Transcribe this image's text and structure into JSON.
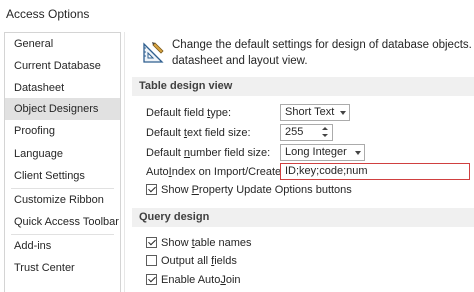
{
  "window": {
    "title": "Access Options"
  },
  "sidebar": {
    "items": [
      {
        "label": "General"
      },
      {
        "label": "Current Database"
      },
      {
        "label": "Datasheet"
      },
      {
        "label": "Object Designers",
        "selected": true
      },
      {
        "label": "Proofing"
      },
      {
        "label": "Language"
      },
      {
        "label": "Client Settings"
      },
      {
        "label": "Customize Ribbon"
      },
      {
        "label": "Quick Access Toolbar"
      },
      {
        "label": "Add-ins"
      },
      {
        "label": "Trust Center"
      }
    ]
  },
  "intro": {
    "icon": "design-ruler-icon",
    "line1": "Change the default settings for design of database objects. Mo",
    "line2": "datasheet and layout view."
  },
  "table_design": {
    "header": "Table design view",
    "field_type": {
      "pre": "Default field ",
      "accel": "t",
      "post": "ype:",
      "value": "Short Text"
    },
    "text_size": {
      "pre": "Default ",
      "accel": "t",
      "post": "ext field size:",
      "value": "255"
    },
    "number_size": {
      "pre": "Default ",
      "accel": "n",
      "post": "umber field size:",
      "value": "Long Integer"
    },
    "autoindex": {
      "pre": "Auto",
      "accel": "I",
      "post": "ndex on Import/Create:",
      "value": "ID;key;code;num"
    },
    "show_property": {
      "pre": "Show ",
      "accel": "P",
      "post": "roperty Update Options buttons",
      "checked": true
    }
  },
  "query_design": {
    "header": "Query design",
    "show_table_names": {
      "pre": "Show ",
      "accel": "t",
      "post": "able names",
      "checked": true
    },
    "output_all_fields": {
      "pre": "Output all ",
      "accel": "f",
      "post": "ields",
      "checked": false
    },
    "enable_autojoin": {
      "pre": "Enable Auto",
      "accel": "J",
      "post": "oin",
      "checked": true
    }
  },
  "colors": {
    "selected_bg": "#e1e1e1",
    "section_bg": "#f0f0f0",
    "error_border": "#d04040"
  }
}
